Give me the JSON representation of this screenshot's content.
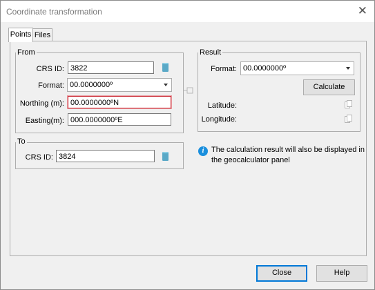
{
  "window": {
    "title": "Coordinate transformation"
  },
  "tabs": [
    {
      "label": "Points"
    },
    {
      "label": "Files"
    }
  ],
  "from": {
    "legend": "From",
    "crs_label": "CRS ID:",
    "crs_value": "3822",
    "format_label": "Format:",
    "format_value": "00.0000000º",
    "northing_label": "Northing (m):",
    "northing_value": "00.0000000ºN",
    "easting_label": "Easting(m):",
    "easting_value": "000.0000000ºE"
  },
  "to": {
    "legend": "To",
    "crs_label": "CRS ID:",
    "crs_value": "3824"
  },
  "result": {
    "legend": "Result",
    "format_label": "Format:",
    "format_value": "00.0000000º",
    "calculate_label": "Calculate",
    "latitude_label": "Latitude:",
    "longitude_label": "Longitude:"
  },
  "info": {
    "text_line1": "The calculation result will also be displayed in",
    "text_line2": "the geocalculator panel"
  },
  "footer": {
    "close_label": "Close",
    "help_label": "Help"
  },
  "colors": {
    "error_border": "#c8202b",
    "info_icon": "#1a8fdd",
    "default_button_border": "#0078d7"
  }
}
